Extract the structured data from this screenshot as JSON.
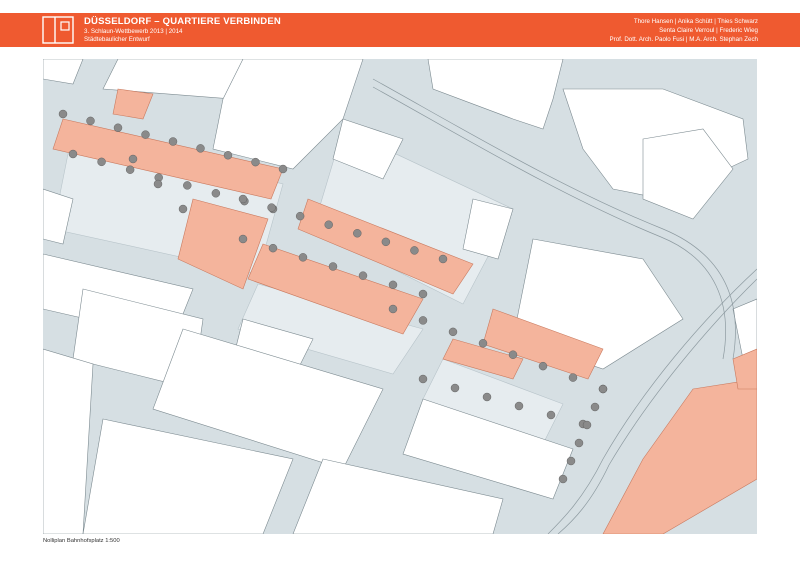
{
  "header": {
    "title": "DÜSSELDORF – QUARTIERE VERBINDEN",
    "subtitle_line1": "3. Schlaun-Wettbewerb 2013 | 2014",
    "subtitle_line2": "Städtebaulicher Entwurf",
    "credits": [
      "Thore Hansen | Anika Schütt | Thies Schwarz",
      "Senta Claire Verroul | Frederic Wieg",
      "Prof. Dott. Arch. Paolo Fusi | M.A. Arch. Stephan Zech"
    ]
  },
  "map": {
    "caption": "Nolliplan Bahnhofsplatz 1:500",
    "colors": {
      "accent": "#ef5a30",
      "street": "#d6dfe3",
      "building": "#ffffff",
      "highlight_building": "#f4b49c",
      "courtyard": "#e6ecef",
      "tree": "#8a8a8a"
    }
  }
}
